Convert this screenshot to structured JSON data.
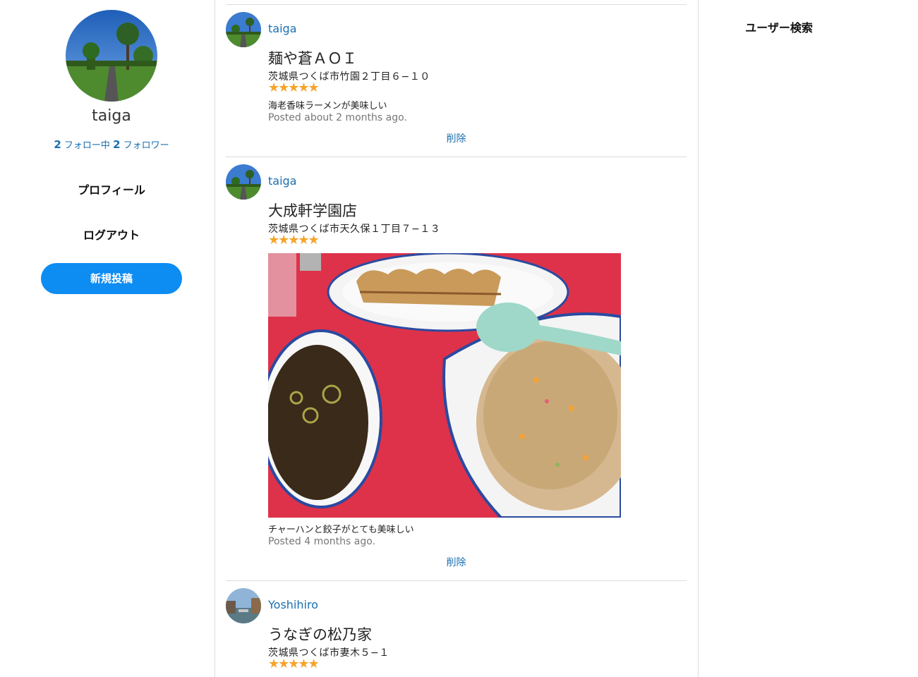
{
  "sidebar": {
    "username": "taiga",
    "following_count": "2",
    "following_label": "フォロー中",
    "followers_count": "2",
    "followers_label": "フォロワー",
    "profile_label": "プロフィール",
    "logout_label": "ログアウト",
    "new_post_label": "新規投稿"
  },
  "right": {
    "user_search_label": "ユーザー検索"
  },
  "posts": [
    {
      "user": "taiga",
      "title": "麺や蒼ＡＯＩ",
      "address": "茨城県つくば市竹園２丁目６−１０",
      "stars": "★★★★★",
      "rating": 5,
      "body": "海老香味ラーメンが美味しい",
      "time": "Posted about 2 months ago.",
      "delete_label": "削除"
    },
    {
      "user": "taiga",
      "title": "大成軒学園店",
      "address": "茨城県つくば市天久保１丁目７−１３",
      "stars": "★★★★★",
      "rating": 5,
      "body": "チャーハンと餃子がとても美味しい",
      "time": "Posted 4 months ago.",
      "delete_label": "削除"
    },
    {
      "user": "Yoshihiro",
      "title": "うなぎの松乃家",
      "address": "茨城県つくば市妻木５−１",
      "stars": "★★★★★",
      "rating": 5
    }
  ],
  "colors": {
    "link": "#1a6fb0",
    "accent_button": "#0d8cf2",
    "star": "#f5a42a",
    "divider": "#dcdcdc"
  }
}
